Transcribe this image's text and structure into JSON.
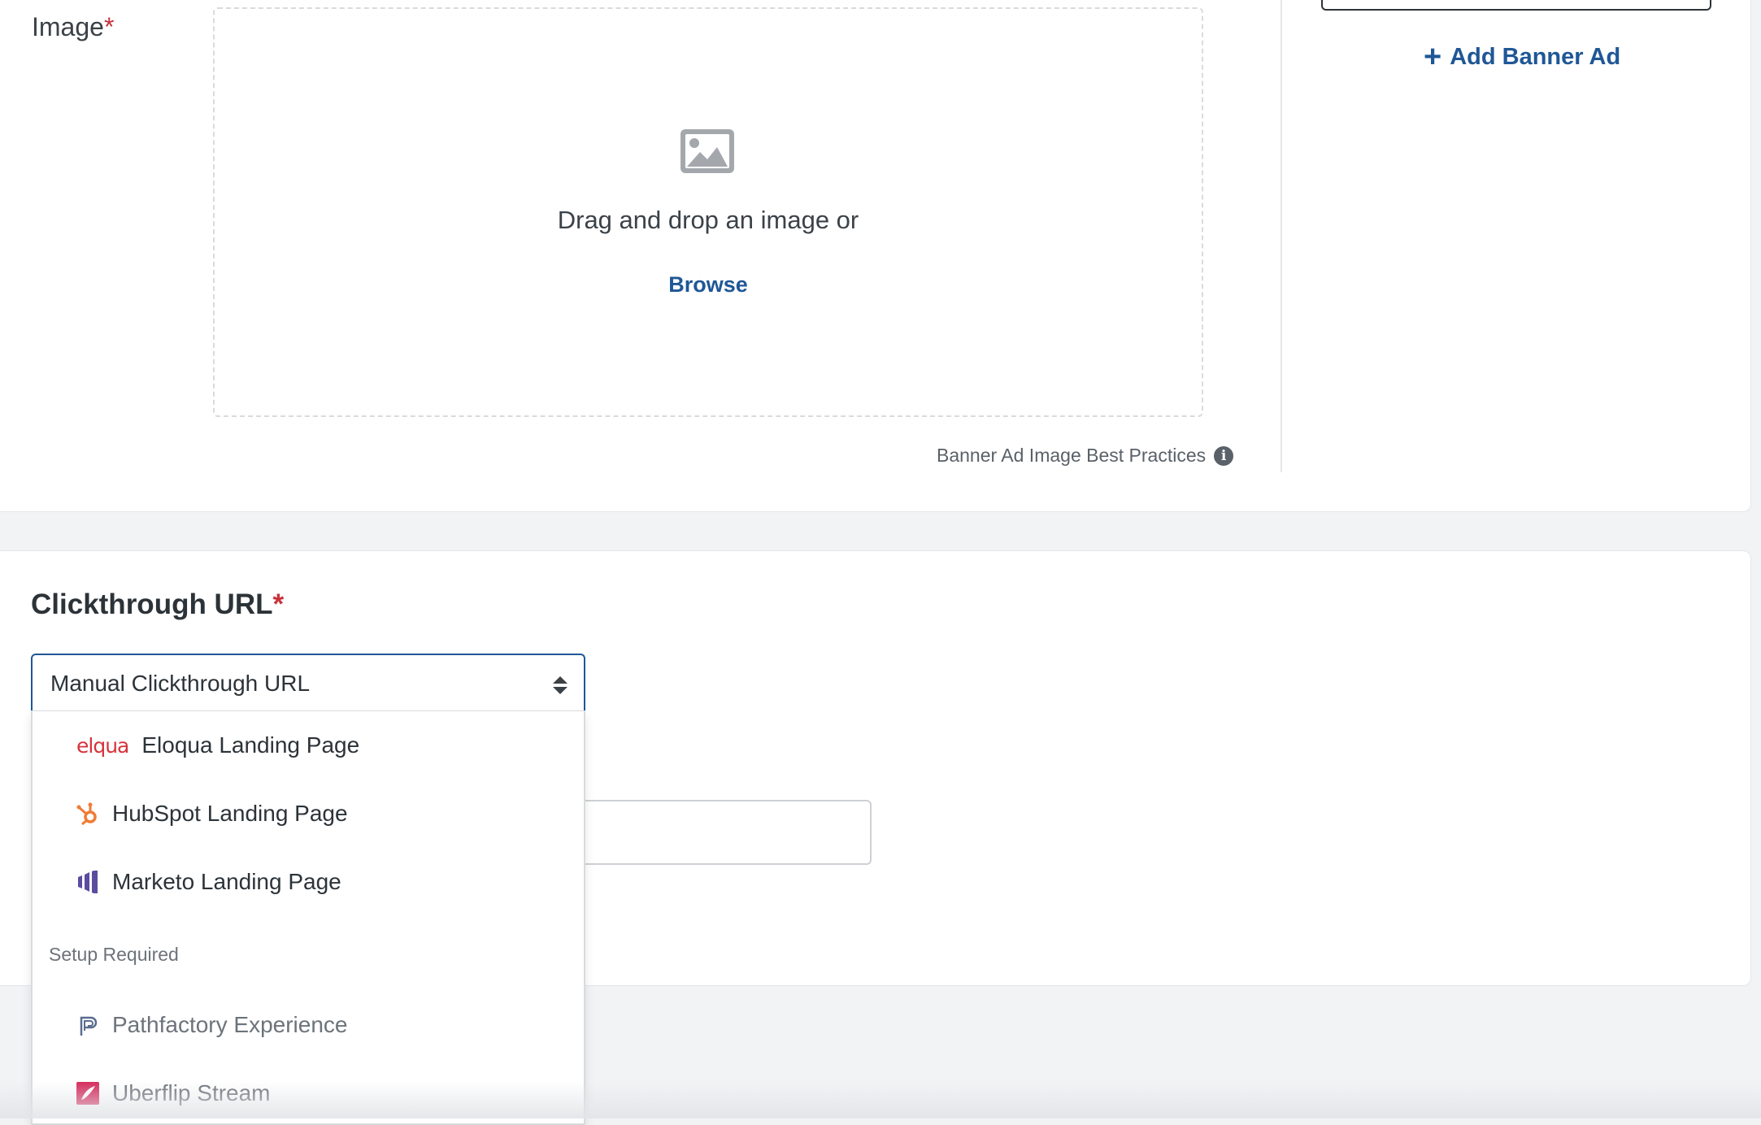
{
  "image_field": {
    "label": "Image",
    "required_mark": "*",
    "dropzone_text": "Drag and drop an image or",
    "browse_label": "Browse",
    "best_practices_label": "Banner Ad Image Best Practices",
    "info_glyph": "i",
    "image_icon": "image-placeholder-icon"
  },
  "sidebar": {
    "add_banner_label": "Add Banner Ad",
    "plus_glyph": "+"
  },
  "clickthrough": {
    "title": "Clickthrough URL",
    "required_mark": "*",
    "select_value": "Manual Clickthrough URL",
    "options": [
      {
        "label": "Eloqua Landing Page",
        "logo": "eloqua-logo",
        "logo_text": "elqua",
        "color": "#d6333c"
      },
      {
        "label": "HubSpot Landing Page",
        "logo": "hubspot-icon",
        "color": "#f07b35"
      },
      {
        "label": "Marketo Landing Page",
        "logo": "marketo-icon",
        "color": "#5c4c9f"
      }
    ],
    "group_header": "Setup Required",
    "setup_options": [
      {
        "label": "Pathfactory Experience",
        "logo": "pathfactory-icon",
        "color": "#5b6d8f"
      },
      {
        "label": "Uberflip Stream",
        "logo": "uberflip-icon",
        "color": "#d62b5c"
      }
    ]
  },
  "colors": {
    "accent": "#1f5796",
    "required": "#c8323c",
    "page_bg": "#f2f3f5"
  }
}
